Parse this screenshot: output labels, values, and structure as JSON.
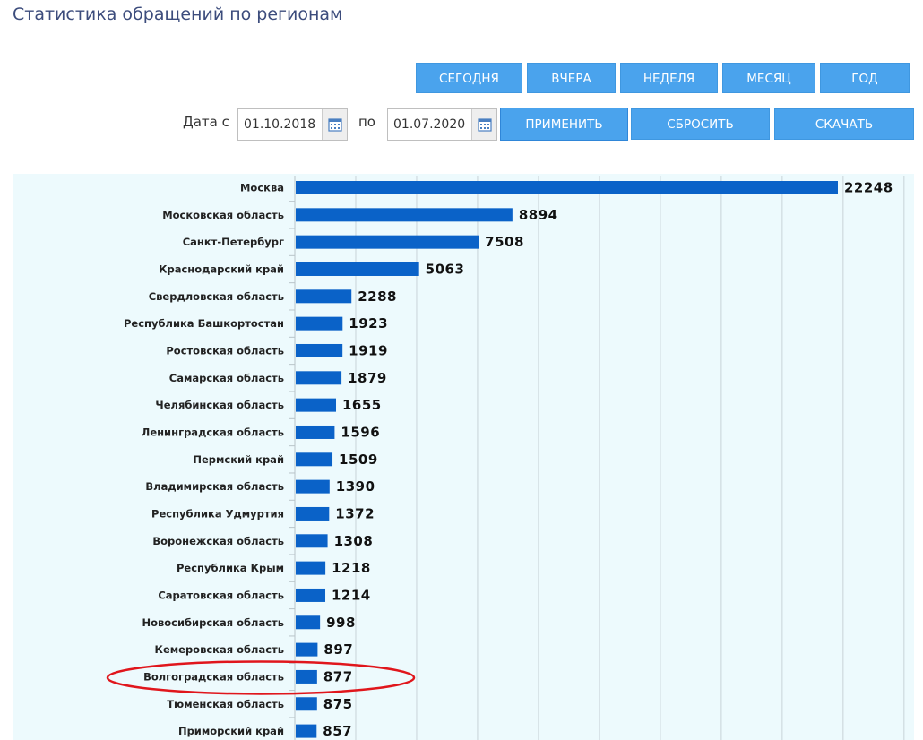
{
  "page": {
    "title": "Статистика обращений по регионам"
  },
  "periods": [
    {
      "label": "СЕГОДНЯ"
    },
    {
      "label": "ВЧЕРА"
    },
    {
      "label": "НЕДЕЛЯ"
    },
    {
      "label": "МЕСЯЦ"
    },
    {
      "label": "ГОД"
    }
  ],
  "filters": {
    "date_from_label": "Дата с",
    "date_from": "01.10.2018",
    "date_to_label": "по",
    "date_to": "01.07.2020",
    "apply_label": "ПРИМЕНИТЬ",
    "reset_label": "СБРОСИТЬ",
    "download_label": "СКАЧАТЬ"
  },
  "colors": {
    "button": "#4aa3ed",
    "bar": "#0a62c8",
    "chart_background": "#edfafd",
    "highlight": "#e0161c"
  },
  "chart_data": {
    "type": "bar",
    "orientation": "horizontal",
    "title": "",
    "xlabel": "",
    "ylabel": "",
    "grid": true,
    "xlim": [
      0,
      25000
    ],
    "highlighted_category": "Волгоградская область",
    "categories": [
      "Москва",
      "Московская область",
      "Санкт-Петербург",
      "Краснодарский край",
      "Свердловская область",
      "Республика Башкортостан",
      "Ростовская область",
      "Самарская область",
      "Челябинская область",
      "Ленинградская область",
      "Пермский край",
      "Владимирская область",
      "Республика Удмуртия",
      "Воронежская область",
      "Республика Крым",
      "Саратовская область",
      "Новосибирская область",
      "Кемеровская область",
      "Волгоградская область",
      "Тюменская область",
      "Приморский край"
    ],
    "values": [
      22248,
      8894,
      7508,
      5063,
      2288,
      1923,
      1919,
      1879,
      1655,
      1596,
      1509,
      1390,
      1372,
      1308,
      1218,
      1214,
      998,
      897,
      877,
      875,
      857
    ]
  }
}
